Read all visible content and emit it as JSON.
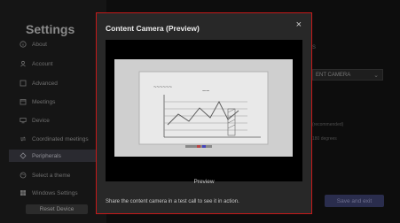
{
  "sidebar": {
    "title": "Settings",
    "items": [
      {
        "label": "About",
        "icon": "info-icon"
      },
      {
        "label": "Account",
        "icon": "account-icon"
      },
      {
        "label": "Advanced",
        "icon": "advanced-icon"
      },
      {
        "label": "Meetings",
        "icon": "meetings-icon"
      },
      {
        "label": "Device",
        "icon": "device-icon"
      },
      {
        "label": "Coordinated meetings",
        "icon": "coordinated-icon"
      },
      {
        "label": "Peripherals",
        "icon": "peripherals-icon"
      },
      {
        "label": "Select a theme",
        "icon": "theme-icon"
      },
      {
        "label": "Windows Settings",
        "icon": "windows-icon"
      }
    ],
    "reset_label": "Reset Device"
  },
  "background": {
    "select_value": "ENT CAMERA",
    "note1": "(recommended)",
    "note2": "180 degrees",
    "save_label": "Save and exit"
  },
  "modal": {
    "title": "Content Camera (Preview)",
    "close_glyph": "×",
    "preview_label": "Preview",
    "footer": "Share the content camera in a test call to see it in action."
  },
  "colors": {
    "highlight_border": "#c51a1a",
    "modal_bg": "#282828",
    "save_button": "#2a2d4d"
  }
}
